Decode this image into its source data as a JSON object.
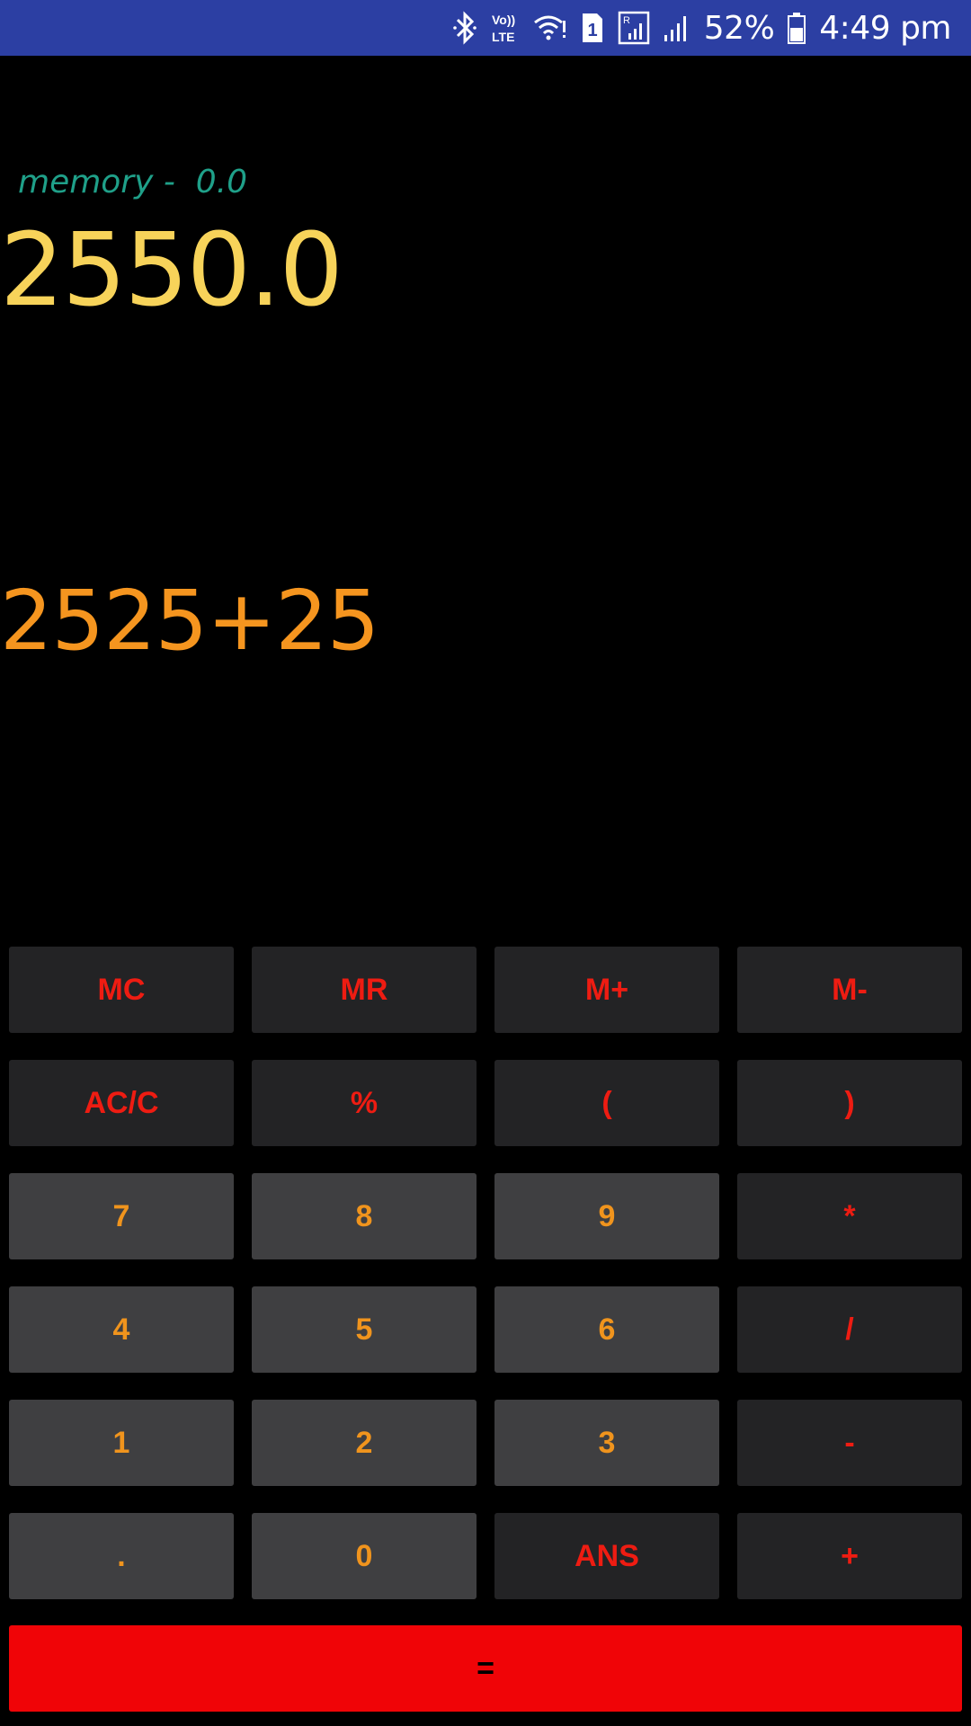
{
  "status_bar": {
    "battery_percent": "52%",
    "time": "4:49 pm",
    "sim_slot": "1",
    "volte_label_top": "Vo))",
    "volte_label_bottom": "LTE",
    "roaming_label": "R",
    "icons": [
      "bluetooth-icon",
      "volte-icon",
      "wifi-icon",
      "sim-icon",
      "roaming-signal-icon",
      "signal-icon",
      "battery-icon"
    ]
  },
  "display": {
    "memory_label": "memory -  0.0",
    "result": "2550.0",
    "expression": "2525+25"
  },
  "keypad": {
    "rows": [
      [
        {
          "label": "MC",
          "style": "dark"
        },
        {
          "label": "MR",
          "style": "dark"
        },
        {
          "label": "M+",
          "style": "dark"
        },
        {
          "label": "M-",
          "style": "dark"
        }
      ],
      [
        {
          "label": "AC/C",
          "style": "dark"
        },
        {
          "label": "%",
          "style": "dark"
        },
        {
          "label": "(",
          "style": "dark"
        },
        {
          "label": ")",
          "style": "dark"
        }
      ],
      [
        {
          "label": "7",
          "style": "light"
        },
        {
          "label": "8",
          "style": "light"
        },
        {
          "label": "9",
          "style": "light"
        },
        {
          "label": "*",
          "style": "dark"
        }
      ],
      [
        {
          "label": "4",
          "style": "light"
        },
        {
          "label": "5",
          "style": "light"
        },
        {
          "label": "6",
          "style": "light"
        },
        {
          "label": "/",
          "style": "dark"
        }
      ],
      [
        {
          "label": "1",
          "style": "light"
        },
        {
          "label": "2",
          "style": "light"
        },
        {
          "label": "3",
          "style": "light"
        },
        {
          "label": "-",
          "style": "dark"
        }
      ],
      [
        {
          "label": ".",
          "style": "light"
        },
        {
          "label": "0",
          "style": "light"
        },
        {
          "label": "ANS",
          "style": "dark"
        },
        {
          "label": "+",
          "style": "dark"
        }
      ]
    ],
    "equals_label": "="
  },
  "colors": {
    "status_bar": "#2c3fa3",
    "memory_text": "#1fa089",
    "result_text": "#f7d35a",
    "expression_text": "#f5951f",
    "operator_text": "#ee1c12",
    "digit_text": "#f0941d",
    "equals_bg": "#f00407"
  }
}
